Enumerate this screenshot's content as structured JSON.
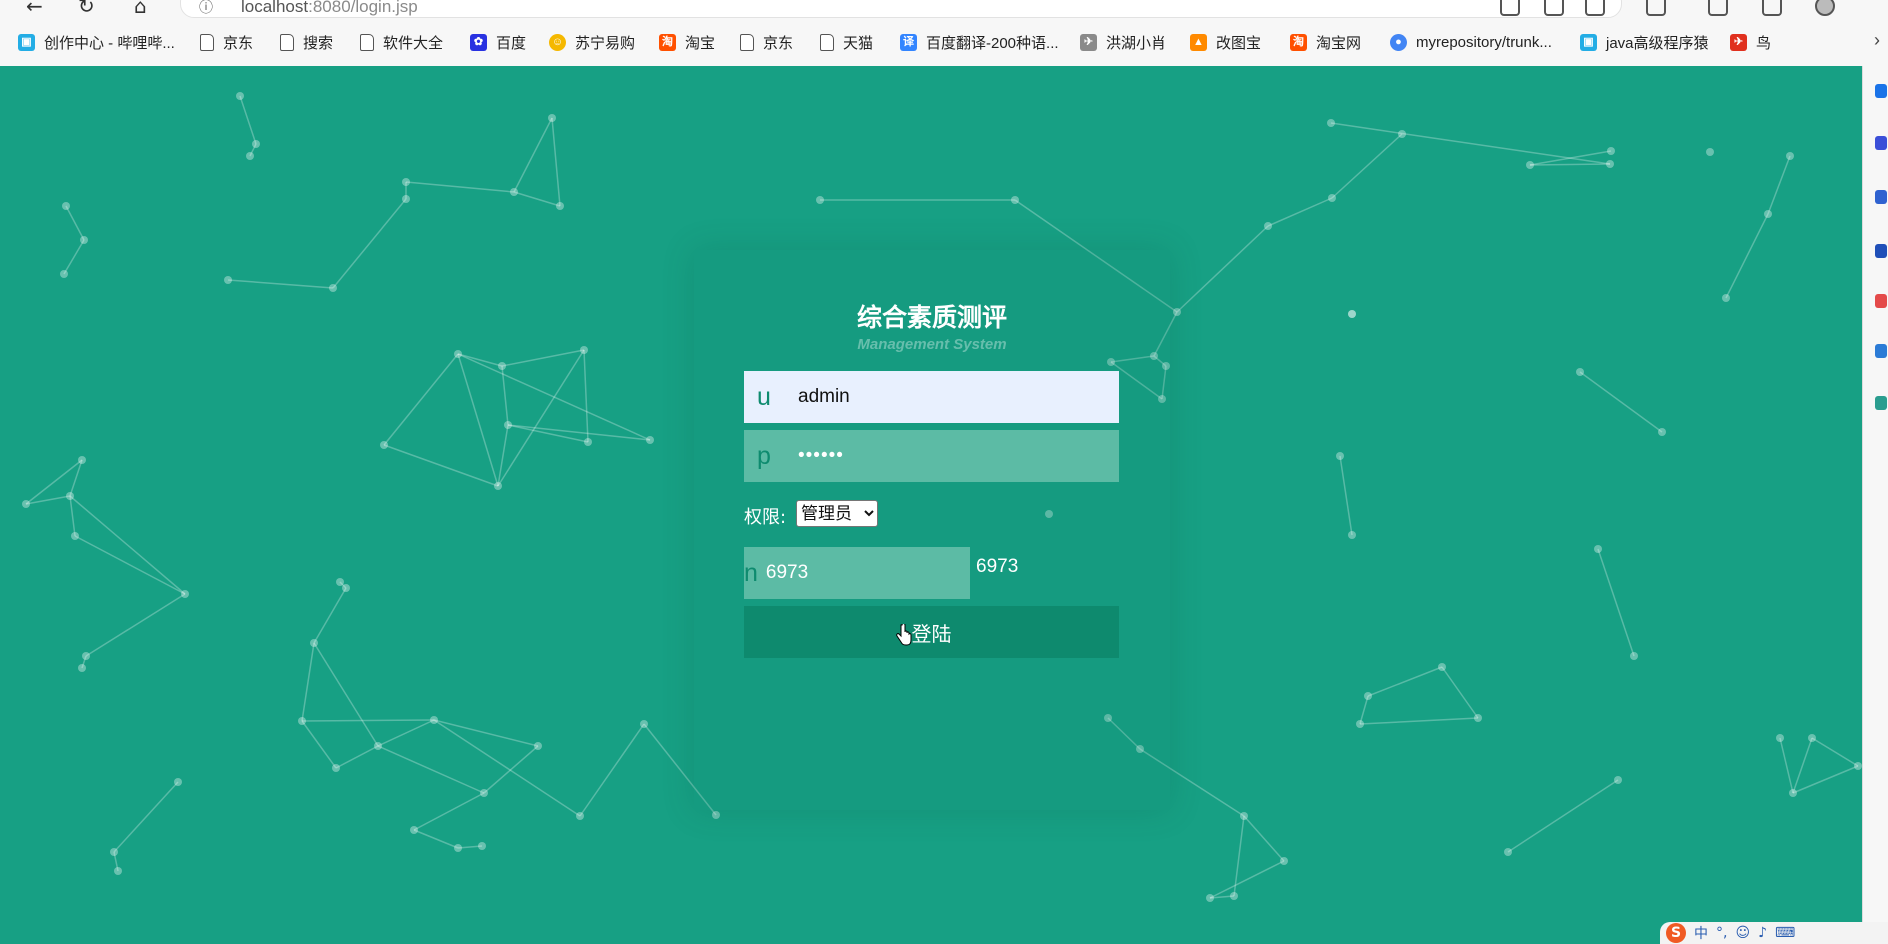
{
  "browser": {
    "url_host": "localhost",
    "url_rest": ":8080/login.jsp"
  },
  "bookmarks": [
    {
      "label": "创作中心 - 哔哩哔...",
      "icon": "bilibili-icon",
      "color": "#23ade5"
    },
    {
      "label": "京东",
      "icon": "page-icon",
      "color": ""
    },
    {
      "label": "搜索",
      "icon": "page-icon",
      "color": ""
    },
    {
      "label": "软件大全",
      "icon": "page-icon",
      "color": ""
    },
    {
      "label": "百度",
      "icon": "baidu-paw-icon",
      "color": "#2932e1"
    },
    {
      "label": "苏宁易购",
      "icon": "suning-icon",
      "color": "#f5b800"
    },
    {
      "label": "淘宝",
      "icon": "taobao-icon",
      "color": "#ff5000"
    },
    {
      "label": "京东",
      "icon": "page-icon",
      "color": ""
    },
    {
      "label": "天猫",
      "icon": "page-icon",
      "color": ""
    },
    {
      "label": "百度翻译-200种语...",
      "icon": "baidu-translate-icon",
      "color": "#3385ff"
    },
    {
      "label": "洪湖小肖",
      "icon": "bird-icon",
      "color": "#8a8a8a"
    },
    {
      "label": "改图宝",
      "icon": "gaitubao-icon",
      "color": "#ff8a00"
    },
    {
      "label": "淘宝网",
      "icon": "taobao-icon",
      "color": "#ff5000"
    },
    {
      "label": "myrepository/trunk...",
      "icon": "chrome-icon",
      "color": "#4285f4"
    },
    {
      "label": "java高级程序猿",
      "icon": "bilibili-icon",
      "color": "#23ade5"
    },
    {
      "label": "鸟",
      "icon": "bird-red-icon",
      "color": "#e0301e"
    }
  ],
  "login": {
    "title": "综合素质测评",
    "subtitle": "Management System",
    "username_prefix": "u",
    "username_value": "admin",
    "password_prefix": "p",
    "password_value": "••••••",
    "role_label": "权限:",
    "role_selected": "管理员",
    "captcha_prefix": "n",
    "captcha_value": "6973",
    "captcha_code": "6973",
    "login_button": "登陆"
  },
  "colors": {
    "background": "#17a084",
    "field": "#5cbba5",
    "button": "#0e8a6e"
  }
}
